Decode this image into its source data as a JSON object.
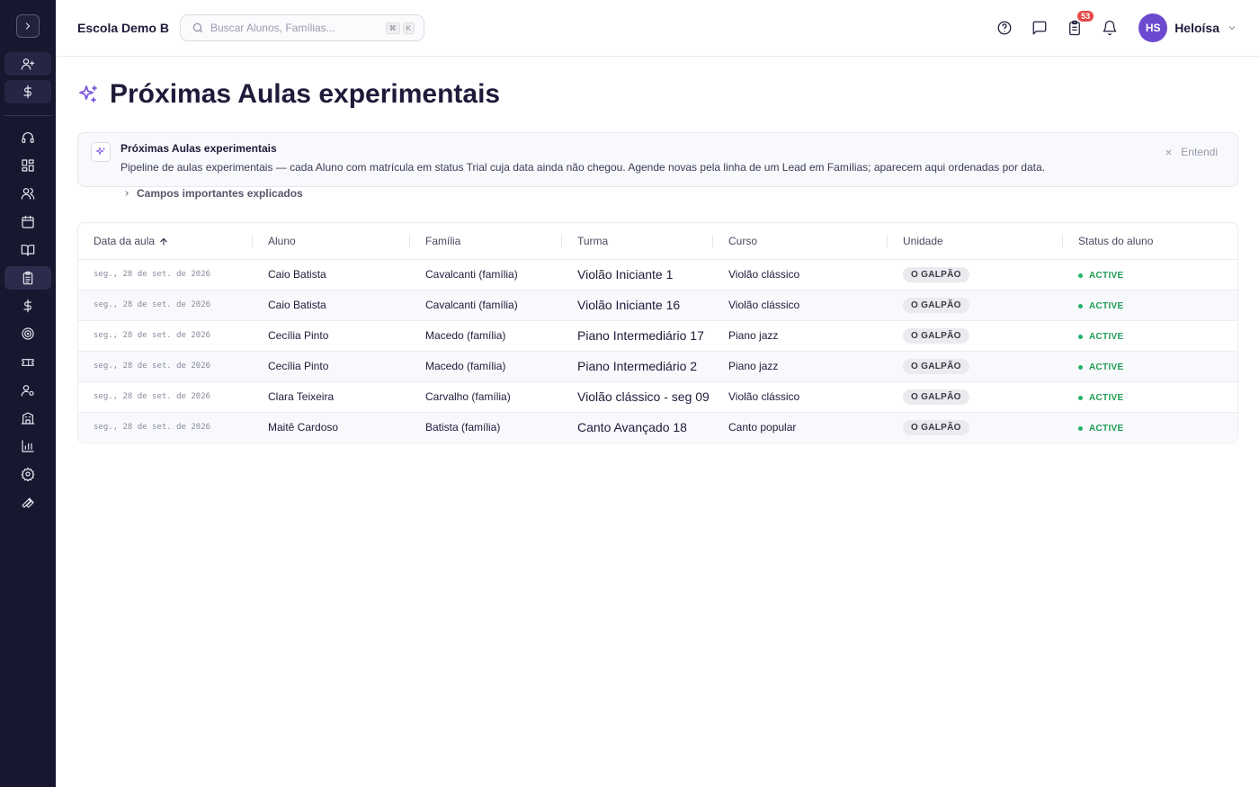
{
  "header": {
    "school": "Escola Demo B",
    "search_placeholder": "Buscar Alunos, Famílias...",
    "kbd_1": "⌘",
    "kbd_2": "K",
    "tasks_badge": "53",
    "user_initials": "HS",
    "user_name": "Heloísa"
  },
  "page": {
    "title": "Próximas Aulas experimentais"
  },
  "info": {
    "title": "Próximas Aulas experimentais",
    "description": "Pipeline de aulas experimentais — cada Aluno com matrícula em status Trial cuja data ainda não chegou. Agende novas pela linha de um Lead em Famílias; aparecem aqui ordenadas por data.",
    "more": "Campos importantes explicados",
    "dismiss": "Entendi"
  },
  "table": {
    "columns": [
      "Data da aula",
      "Aluno",
      "Família",
      "Turma",
      "Curso",
      "Unidade",
      "Status do aluno"
    ],
    "rows": [
      {
        "date": "seg., 28 de set. de 2026",
        "student": "Caio Batista",
        "family": "Cavalcanti (família)",
        "class": "Violão Iniciante 1",
        "course": "Violão clássico",
        "unit": "O GALPÃO",
        "status": "ACTIVE"
      },
      {
        "date": "seg., 28 de set. de 2026",
        "student": "Caio Batista",
        "family": "Cavalcanti (família)",
        "class": "Violão Iniciante 16",
        "course": "Violão clássico",
        "unit": "O GALPÃO",
        "status": "ACTIVE"
      },
      {
        "date": "seg., 28 de set. de 2026",
        "student": "Cecília Pinto",
        "family": "Macedo (família)",
        "class": "Piano Intermediário 17",
        "course": "Piano jazz",
        "unit": "O GALPÃO",
        "status": "ACTIVE"
      },
      {
        "date": "seg., 28 de set. de 2026",
        "student": "Cecília Pinto",
        "family": "Macedo (família)",
        "class": "Piano Intermediário 2",
        "course": "Piano jazz",
        "unit": "O GALPÃO",
        "status": "ACTIVE"
      },
      {
        "date": "seg., 28 de set. de 2026",
        "student": "Clara Teixeira",
        "family": "Carvalho (família)",
        "class": "Violão clássico - seg 09",
        "course": "Violão clássico",
        "unit": "O GALPÃO",
        "status": "ACTIVE"
      },
      {
        "date": "seg., 28 de set. de 2026",
        "student": "Maitê Cardoso",
        "family": "Batista (família)",
        "class": "Canto Avançado 18",
        "course": "Canto popular",
        "unit": "O GALPÃO",
        "status": "ACTIVE"
      }
    ]
  }
}
